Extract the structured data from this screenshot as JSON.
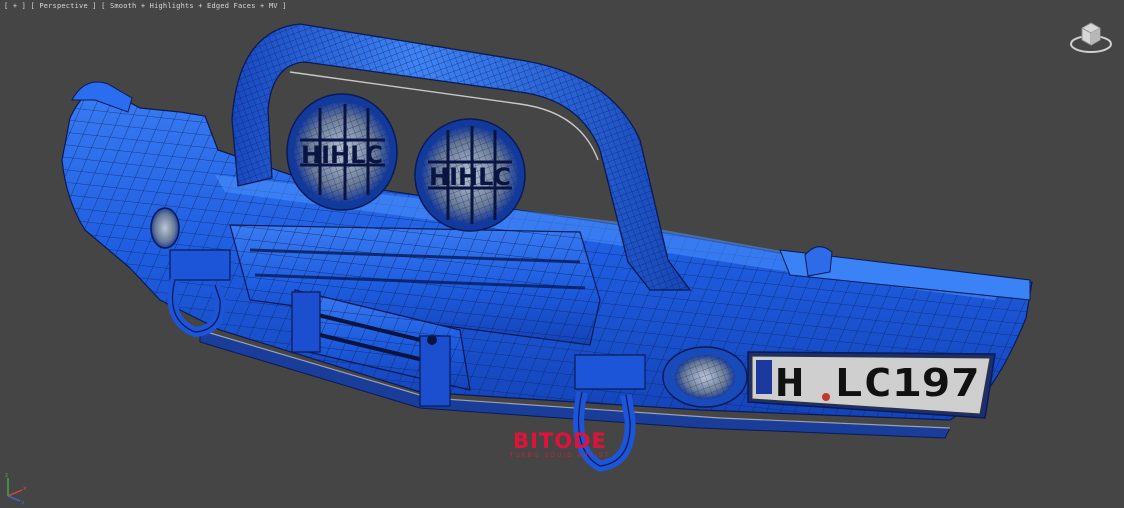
{
  "viewport": {
    "label": "[ + ] [ Perspective ] [ Smooth + Highlights + Edged Faces + MV ]",
    "background": "#454545"
  },
  "model": {
    "subject": "front bumper with bull bar, twin driving lights, winch and license plate",
    "color": "#1f5fe0",
    "wire_color": "#0a1a55",
    "light_badge_text": "HIHLC",
    "plate_text": "H LC197"
  },
  "watermark": {
    "logo": "BITODE",
    "tagline": "TURBO SQUID ARTIST"
  },
  "viewcube": {
    "icon": "viewcube-icon"
  },
  "axis": {
    "icon": "axis-tripod-icon"
  }
}
